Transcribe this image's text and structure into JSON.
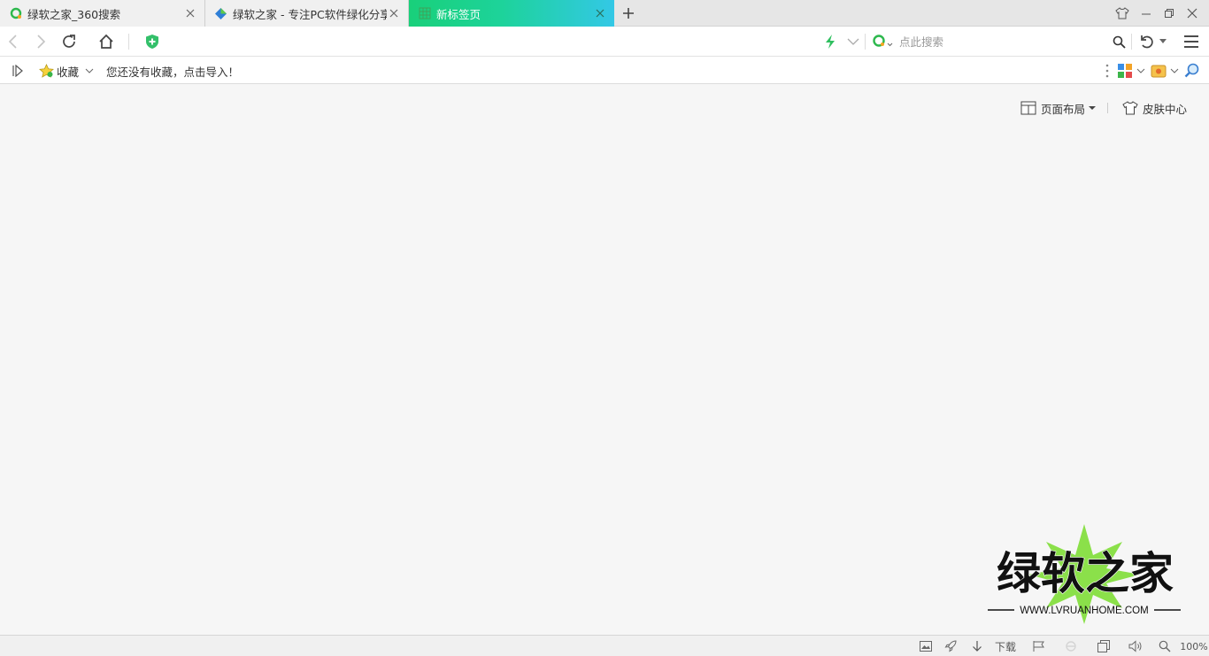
{
  "tabs": [
    {
      "title": "绿软之家_360搜索",
      "icon": "360-search-icon",
      "active": false
    },
    {
      "title": "绿软之家 - 专注PC软件绿化分享",
      "icon": "lvruan-site-icon",
      "active": false
    },
    {
      "title": "新标签页",
      "icon": "grid-newtab-icon",
      "active": true
    }
  ],
  "toolbar": {
    "search_placeholder": "点此搜索"
  },
  "bookmarks": {
    "favorites_label": "收藏",
    "empty_prompt": "您还没有收藏，点击导入！"
  },
  "content": {
    "layout_label": "页面布局",
    "skin_label": "皮肤中心"
  },
  "watermark": {
    "title": "绿软之家",
    "url": "WWW.LVRUANHOME.COM"
  },
  "status": {
    "download_label": "下载",
    "zoom": "100%"
  },
  "colors": {
    "active_tab_start": "#19d07a",
    "active_tab_end": "#33c8e6",
    "accent_green": "#2fbf5f",
    "watermark_star": "#8be04a"
  }
}
